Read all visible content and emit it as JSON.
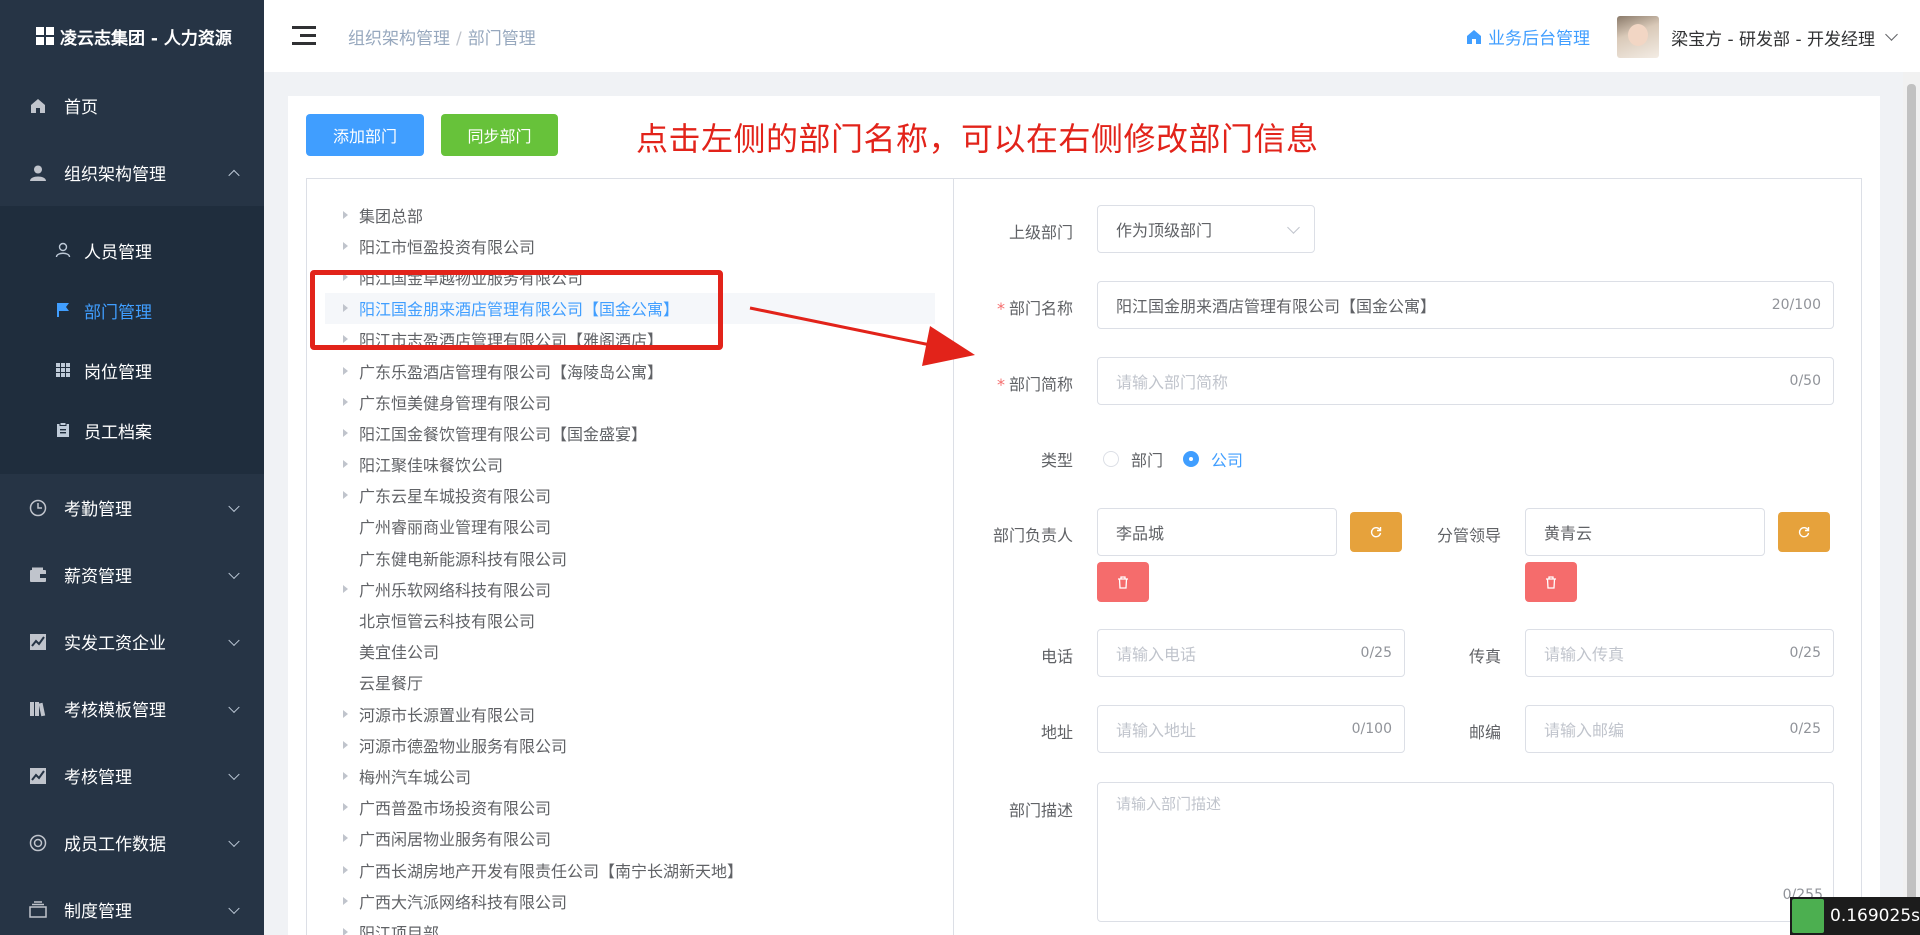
{
  "app": {
    "title": "凌云志集团 - 人力资源"
  },
  "sidebar": {
    "items": [
      {
        "label": "首页"
      },
      {
        "label": "组织架构管理"
      },
      {
        "label": "考勤管理"
      },
      {
        "label": "薪资管理"
      },
      {
        "label": "实发工资企业"
      },
      {
        "label": "考核模板管理"
      },
      {
        "label": "考核管理"
      },
      {
        "label": "成员工作数据"
      },
      {
        "label": "制度管理"
      }
    ],
    "sub": [
      {
        "label": "人员管理"
      },
      {
        "label": "部门管理"
      },
      {
        "label": "岗位管理"
      },
      {
        "label": "员工档案"
      }
    ]
  },
  "header": {
    "breadcrumb": [
      "组织架构管理",
      "部门管理"
    ],
    "biz_label": "业务后台管理",
    "user": "梁宝方 - 研发部 - 开发经理"
  },
  "toolbar": {
    "add_label": "添加部门",
    "sync_label": "同步部门"
  },
  "annotation": "点击左侧的部门名称，可以在右侧修改部门信息",
  "tree": [
    "集团总部",
    "阳江市恒盈投资有限公司",
    "阳江国金卓越物业服务有限公司",
    "阳江国金朋来酒店管理有限公司【国金公寓】",
    "阳江市志盈酒店管理有限公司【雅阁酒店】",
    "广东乐盈酒店管理有限公司【海陵岛公寓】",
    "广东恒美健身管理有限公司",
    "阳江国金餐饮管理有限公司【国金盛宴】",
    "阳江聚佳味餐饮公司",
    "广东云星车城投资有限公司",
    "广州睿丽商业管理有限公司",
    "广东健电新能源科技有限公司",
    "广州乐软网络科技有限公司",
    "北京恒管云科技有限公司",
    "美宜佳公司",
    "云星餐厅",
    "河源市长源置业有限公司",
    "河源市德盈物业服务有限公司",
    "梅州汽车城公司",
    "广西普盈市场投资有限公司",
    "广西闲居物业服务有限公司",
    "广西长湖房地产开发有限责任公司【南宁长湖新天地】",
    "广西大汽派网络科技有限公司",
    "阳江项目部"
  ],
  "form": {
    "parent_label": "上级部门",
    "parent_value": "作为顶级部门",
    "name_label": "部门名称",
    "name_value": "阳江国金朋来酒店管理有限公司【国金公寓】",
    "name_count": "20/100",
    "short_label": "部门简称",
    "short_placeholder": "请输入部门简称",
    "short_count": "0/50",
    "type_label": "类型",
    "type_options": [
      "部门",
      "公司"
    ],
    "head_label": "部门负责人",
    "head_value": "李品城",
    "leader_label": "分管领导",
    "leader_value": "黄青云",
    "phone_label": "电话",
    "phone_placeholder": "请输入电话",
    "phone_count": "0/25",
    "fax_label": "传真",
    "fax_placeholder": "请输入传真",
    "fax_count": "0/25",
    "addr_label": "地址",
    "addr_placeholder": "请输入地址",
    "addr_count": "0/100",
    "zip_label": "邮编",
    "zip_placeholder": "请输入邮编",
    "zip_count": "0/25",
    "desc_label": "部门描述",
    "desc_placeholder": "请输入部门描述",
    "desc_count": "0/255"
  },
  "timer": "0.169025s",
  "colors": {
    "primary": "#409eff",
    "success": "#67c23a",
    "warning": "#e6a23c",
    "danger": "#f56c6c",
    "annotation": "#e2231a",
    "sidebar": "#263445"
  }
}
